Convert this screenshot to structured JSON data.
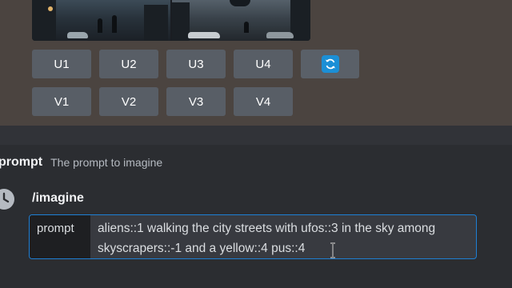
{
  "upscale_buttons": [
    "U1",
    "U2",
    "U3",
    "U4"
  ],
  "variation_buttons": [
    "V1",
    "V2",
    "V3",
    "V4"
  ],
  "reroll_icon": "refresh-icon",
  "option": {
    "name": "prompt",
    "description": "The prompt to imagine"
  },
  "command": {
    "name": "/imagine",
    "icon": "clock-icon"
  },
  "input": {
    "label": "prompt",
    "value": "aliens::1 walking the city streets with ufos::3 in the sky among skyscrapers::-1 and a yellow::4 pus::4"
  },
  "colors": {
    "accent": "#1e7fd4",
    "reroll": "#1b8fd6",
    "button_bg": "#585e66"
  }
}
